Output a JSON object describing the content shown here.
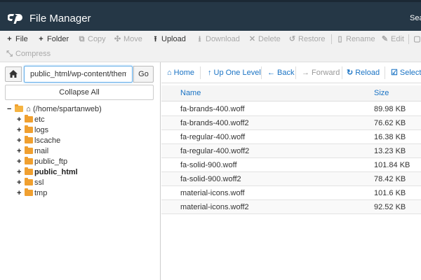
{
  "app": {
    "title": "File Manager",
    "search_label": "Sea",
    "brand_color": "#253746",
    "accent_color": "#1a73c4"
  },
  "toolbar": {
    "row1": [
      {
        "id": "file",
        "label": "File",
        "icon": "plus-icon",
        "enabled": true
      },
      {
        "id": "folder",
        "label": "Folder",
        "icon": "plus-icon",
        "enabled": true
      },
      {
        "id": "copy",
        "label": "Copy",
        "icon": "copy-icon",
        "enabled": false
      },
      {
        "id": "move",
        "label": "Move",
        "icon": "move-icon",
        "enabled": false
      },
      {
        "id": "upload",
        "label": "Upload",
        "icon": "upload-icon",
        "enabled": true
      },
      {
        "id": "download",
        "label": "Download",
        "icon": "download-icon",
        "enabled": false
      },
      {
        "id": "delete",
        "label": "Delete",
        "icon": "times-icon",
        "enabled": false
      },
      {
        "id": "restore",
        "label": "Restore",
        "icon": "undo-icon",
        "enabled": false
      },
      {
        "id": "rename",
        "label": "Rename",
        "icon": "file-icon",
        "enabled": false
      },
      {
        "id": "edit",
        "label": "Edit",
        "icon": "pencil-icon",
        "enabled": false
      }
    ],
    "row2": [
      {
        "id": "compress",
        "label": "Compress",
        "icon": "compress-icon",
        "enabled": false
      }
    ]
  },
  "left_panel": {
    "path_value": "public_html/wp-content/themes/",
    "go_label": "Go",
    "collapse_all_label": "Collapse All",
    "tree": {
      "root_label": "(/home/spartanweb)",
      "children": [
        {
          "label": "etc",
          "bold": false
        },
        {
          "label": "logs",
          "bold": false
        },
        {
          "label": "lscache",
          "bold": false
        },
        {
          "label": "mail",
          "bold": false
        },
        {
          "label": "public_ftp",
          "bold": false
        },
        {
          "label": "public_html",
          "bold": true
        },
        {
          "label": "ssl",
          "bold": false
        },
        {
          "label": "tmp",
          "bold": false
        }
      ]
    }
  },
  "nav": {
    "home_label": "Home",
    "up_label": "Up One Level",
    "back_label": "Back",
    "forward_label": "Forward",
    "reload_label": "Reload",
    "select_all_label": "Select A"
  },
  "file_table": {
    "columns": {
      "name": "Name",
      "size": "Size"
    },
    "rows": [
      {
        "name": "fa-brands-400.woff",
        "size": "89.98 KB"
      },
      {
        "name": "fa-brands-400.woff2",
        "size": "76.62 KB"
      },
      {
        "name": "fa-regular-400.woff",
        "size": "16.38 KB"
      },
      {
        "name": "fa-regular-400.woff2",
        "size": "13.23 KB"
      },
      {
        "name": "fa-solid-900.woff",
        "size": "101.84 KB"
      },
      {
        "name": "fa-solid-900.woff2",
        "size": "78.42 KB"
      },
      {
        "name": "material-icons.woff",
        "size": "101.6 KB"
      },
      {
        "name": "material-icons.woff2",
        "size": "92.52 KB"
      }
    ]
  }
}
